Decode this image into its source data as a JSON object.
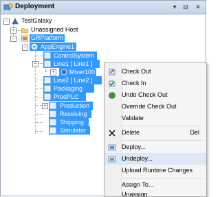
{
  "window": {
    "title": "Deployment",
    "pin_glyph": "⊟",
    "close_glyph": "✕",
    "dropdown_glyph": "▾"
  },
  "tree": {
    "root": "TestGalaxy",
    "unassigned": "Unassigned Host",
    "platform": "GRPlatform",
    "engine": "AppEngine1",
    "control": "ControlSystem",
    "line1": "Line1 [ Line1 ]",
    "mixer": "Mixer100",
    "line2": "Line2 [ Line2 ]",
    "packaging": "Packaging",
    "prodplc": "ProdPLC",
    "production": "Production",
    "receiving": "Receiving",
    "shipping": "Shipping",
    "simulator": "Simulator"
  },
  "menu": {
    "check_out": "Check Out",
    "check_in": "Check In",
    "undo_check_out": "Undo Check Out",
    "override_check_out": "Override Check Out",
    "validate": "Validate",
    "delete": "Delete",
    "delete_shortcut": "Del",
    "deploy": "Deploy...",
    "undeploy": "Undeploy...",
    "upload": "Upload Runtime Changes",
    "assign_to": "Assign To...",
    "unassign": "Unassign"
  },
  "colors": {
    "selection": "#3399ff",
    "menu_highlight": "#dde8f5",
    "titlebar": "#c3d3e8"
  }
}
